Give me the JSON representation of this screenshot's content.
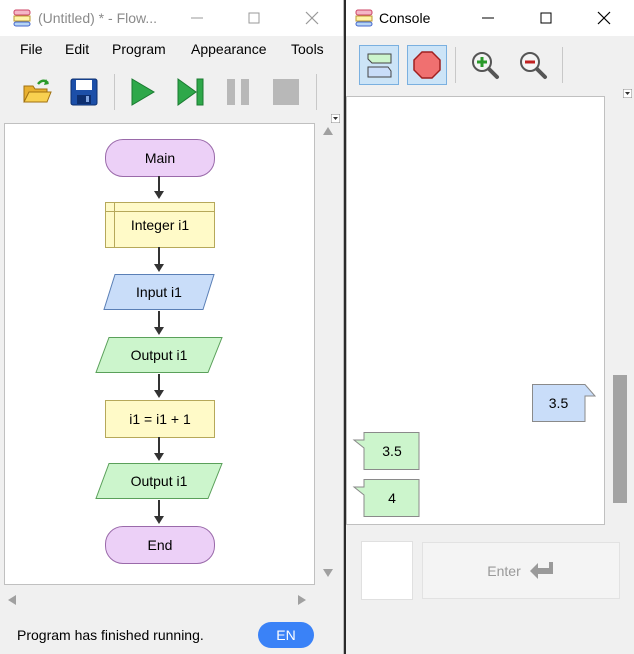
{
  "flowgorithm": {
    "title": "(Untitled) * - Flow...",
    "menu": [
      "File",
      "Edit",
      "Program",
      "Appearance",
      "Tools"
    ],
    "nodes": {
      "main": "Main",
      "declare": "Integer i1",
      "input": "Input i1",
      "output1": "Output i1",
      "assign": "i1 = i1 + 1",
      "output2": "Output i1",
      "end": "End"
    },
    "status": "Program has finished running.",
    "lang": "EN"
  },
  "console": {
    "title": "Console",
    "messages": [
      {
        "type": "input",
        "text": "3.5"
      },
      {
        "type": "output",
        "text": "3.5"
      },
      {
        "type": "output",
        "text": "4"
      }
    ],
    "enter_label": "Enter"
  },
  "colors": {
    "terminal": "#ecd0f7",
    "declare": "#fffac8",
    "input": "#c9ddf9",
    "output": "#ccf5cc",
    "process": "#fffac8",
    "en_button": "#3a82f7"
  }
}
